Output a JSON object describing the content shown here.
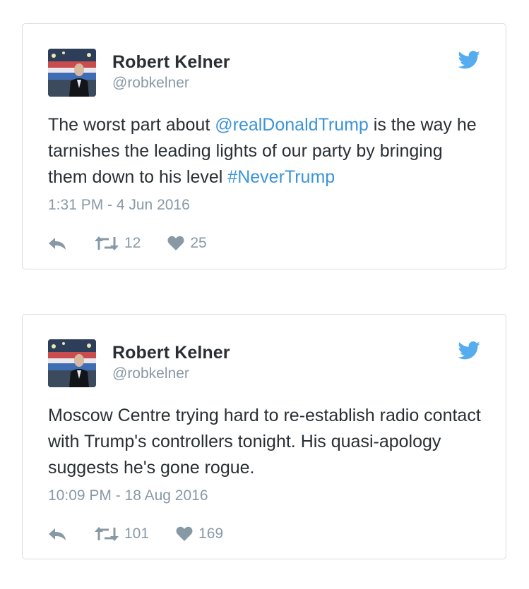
{
  "colors": {
    "link": "#3b94d9",
    "secondary_text": "#8899a6",
    "primary_text": "#292f33",
    "twitter_blue": "#55acee",
    "card_border": "#d8dde1"
  },
  "tweets": [
    {
      "display_name": "Robert Kelner",
      "screen_name": "@robkelner",
      "text_before_mention": "The worst part about ",
      "mention": "@realDonaldTrump",
      "text_after_mention": " is the way he tarnishes the leading lights of our party by bringing them down to his level ",
      "hashtag": "#NeverTrump",
      "timestamp": "1:31 PM - 4 Jun 2016",
      "retweets": "12",
      "likes": "25",
      "icons": {
        "reply": "reply-icon",
        "retweet": "retweet-icon",
        "like": "heart-icon",
        "brand": "twitter-bird-icon"
      }
    },
    {
      "display_name": "Robert Kelner",
      "screen_name": "@robkelner",
      "text": "Moscow Centre trying hard to re-establish radio contact with Trump's controllers tonight. His quasi-apology suggests he's gone rogue.",
      "timestamp": "10:09 PM - 18 Aug 2016",
      "retweets": "101",
      "likes": "169",
      "icons": {
        "reply": "reply-icon",
        "retweet": "retweet-icon",
        "like": "heart-icon",
        "brand": "twitter-bird-icon"
      }
    }
  ]
}
